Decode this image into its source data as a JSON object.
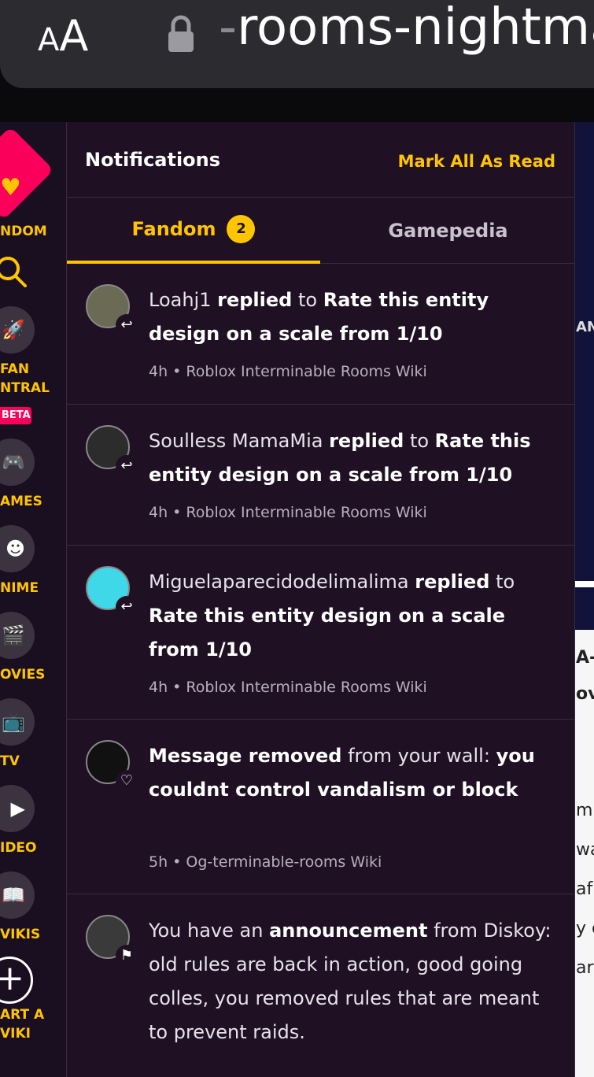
{
  "browser": {
    "reader_small": "A",
    "reader_large": "A",
    "url_prefix": "-",
    "url_text": "rooms-nightma"
  },
  "rail": {
    "logo_label": "NDOM",
    "items": [
      {
        "label": "FAN",
        "label2": "NTRAL",
        "badge": "BETA",
        "icon": "rocket-icon"
      },
      {
        "label": "AMES",
        "icon": "gamepad-icon"
      },
      {
        "label": "NIME",
        "icon": "anime-face-icon"
      },
      {
        "label": "OVIES",
        "icon": "clapperboard-icon"
      },
      {
        "label": "TV",
        "icon": "tv-icon"
      },
      {
        "label": "IDEO",
        "icon": "play-icon"
      },
      {
        "label": "VIKIS",
        "icon": "book-icon"
      }
    ],
    "start_label1": "ART A",
    "start_label2": "VIKI"
  },
  "background_text": [
    "AN",
    "A-",
    "ov",
    "m",
    "wa",
    "af",
    "y c",
    "ar"
  ],
  "panel": {
    "title": "Notifications",
    "mark_all": "Mark All As Read",
    "tabs": [
      {
        "label": "Fandom",
        "count": "2"
      },
      {
        "label": "Gamepedia"
      }
    ]
  },
  "notifications": [
    {
      "user": "Loahj1",
      "action": "replied",
      "connector": "to",
      "target": "Rate this entity design on a scale from 1/10",
      "meta": "4h • Roblox Interminable Rooms Wiki",
      "badge_icon": "reply-icon",
      "avatar_color": "#5a5a4a"
    },
    {
      "user": "Soulless MamaMia",
      "action": "replied",
      "connector": "to",
      "target": "Rate this entity design on a scale from 1/10",
      "meta": "4h • Roblox Interminable Rooms Wiki",
      "badge_icon": "reply-icon",
      "avatar_color": "#2a2a2a"
    },
    {
      "user": "Miguelaparecidodelimalima",
      "action": "replied",
      "connector": "to",
      "target": "Rate this entity design on a scale from 1/10",
      "meta": "4h • Roblox Interminable Rooms Wiki",
      "badge_icon": "reply-icon",
      "avatar_color": "#3fd8e8"
    },
    {
      "lead": "Message removed",
      "middle": "from your wall:",
      "body": "you couldnt control vandalism or block",
      "meta": "5h • Og-terminable-rooms Wiki",
      "badge_icon": "heart-icon",
      "avatar_color": "#111111"
    },
    {
      "pre": "You have an",
      "lead": "announcement",
      "middle": "from Diskoy:",
      "body": "old rules are back in action, good going colles, you removed rules that are meant to prevent raids.",
      "badge_icon": "flag-icon",
      "avatar_color": "#444444"
    }
  ],
  "colors": {
    "accent": "#ffc500",
    "brand_pink": "#fa005a",
    "panel_bg": "#1f1024"
  }
}
